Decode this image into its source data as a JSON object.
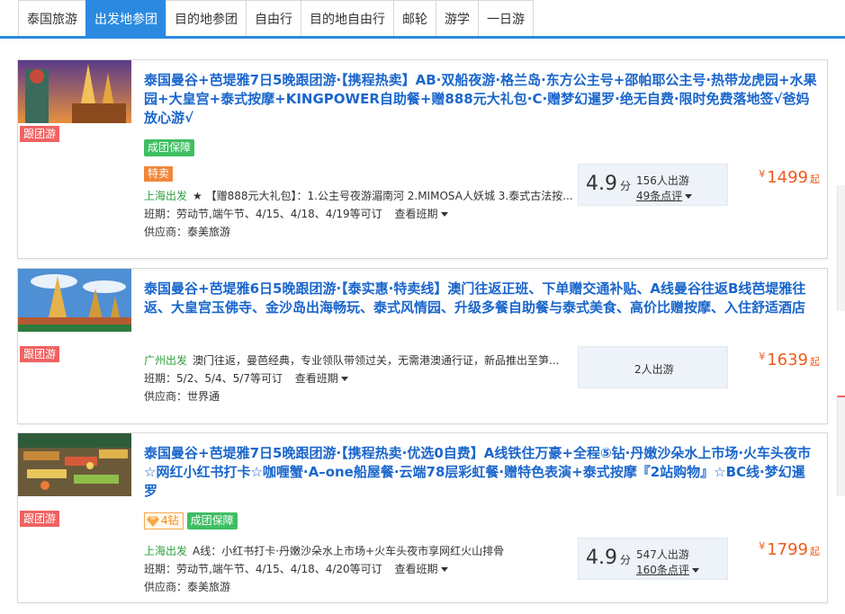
{
  "tabs": [
    "泰国旅游",
    "出发地参团",
    "目的地参团",
    "自由行",
    "目的地自由行",
    "邮轮",
    "游学",
    "一日游"
  ],
  "common": {
    "follow_tag": "跟团游",
    "guarantee": "成团保障",
    "schedule_label": "班期：",
    "supplier_label": "供应商：",
    "view_schedule": "查看班期",
    "price_currency": "¥",
    "price_suffix": "起",
    "score_unit": "分"
  },
  "products": [
    {
      "title": "泰国曼谷+芭堤雅7日5晚跟团游·【携程热卖】AB·双船夜游·格兰岛·东方公主号+邵帕耶公主号·热带龙虎园+水果园+大皇宫+泰式按摩+KINGPOWER自助餐+赠888元大礼包·C·赠梦幻暹罗·绝无自费·限时免费落地签√爸妈放心游√",
      "special_tag": "特卖",
      "depart": "上海出发",
      "desc": "★ 【赠888元大礼包】：1.公主号夜游湄南河 2.MIMOSA人妖城 3.泰式古法按...",
      "schedule": "劳动节,端午节、4/15、4/18、4/19等可订",
      "supplier": "泰美旅游",
      "score": "4.9",
      "travelers": "156人出游",
      "reviews": "49条点评",
      "price": "1499"
    },
    {
      "title": "泰国曼谷+芭堤雅6日5晚跟团游·【泰实惠·特卖线】澳门往返正班、下单赠交通补贴、A线曼谷往返B线芭堤雅往返、大皇宫玉佛寺、金沙岛出海畅玩、泰式风情园、升级多餐自助餐与泰式美食、高价比赠按摩、入住舒适酒店",
      "depart": "广州出发",
      "desc": "澳门往返，曼芭经典，专业领队带领过关，无需港澳通行证，新品推出至笋...",
      "schedule": "5/2、5/4、5/7等可订",
      "supplier": "世界通",
      "travelers": "2人出游",
      "price": "1639"
    },
    {
      "title": "泰国曼谷+芭堤雅7日5晚跟团游·【携程热卖·优选0自费】A线铁住万豪+全程⑤钻·丹嫩沙朵水上市场·火车头夜市☆网红小红书打卡☆咖喱蟹·A–one船屋餐·云端78层彩虹餐·赠特色表演+泰式按摩『2站购物』☆BC线·梦幻暹罗",
      "diamond": "4钻",
      "depart": "上海出发",
      "desc": "A线：小红书打卡·丹嫩沙朵水上市场+火车头夜市享网红火山排骨",
      "schedule": "劳动节,端午节、4/15、4/18、4/20等可订",
      "supplier": "泰美旅游",
      "score": "4.9",
      "travelers": "547人出游",
      "reviews": "160条点评",
      "price": "1799"
    }
  ]
}
